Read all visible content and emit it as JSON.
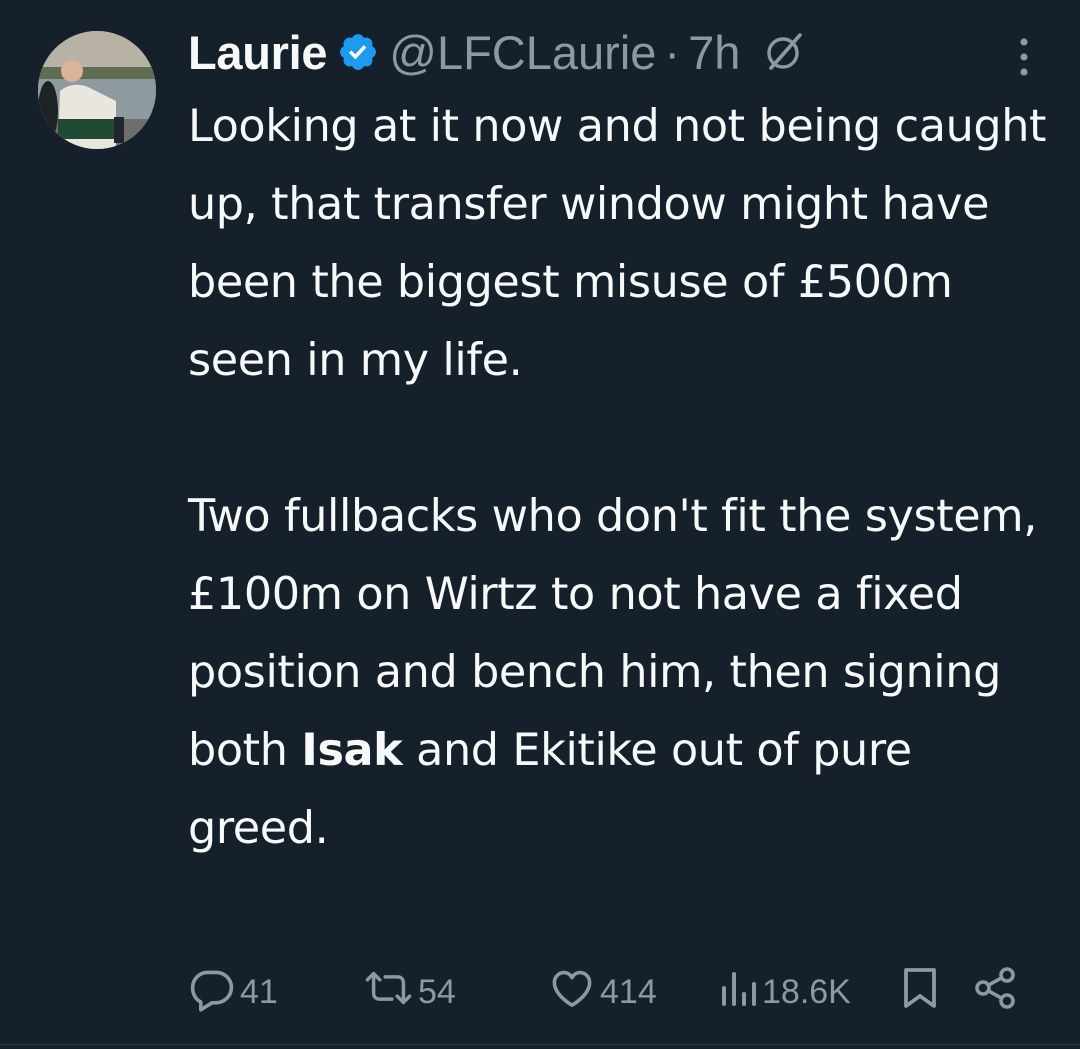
{
  "author": {
    "name": "Laurie",
    "handle": "@LFCLaurie",
    "separator": "·",
    "time": "7h",
    "verified": true,
    "accent_color": "#1d9bf0"
  },
  "tweet": {
    "paragraph1": "Looking at it now and not being caught up, that transfer window might have been the biggest misuse of £500m seen in my life.",
    "paragraph2_before_bold": "Two fullbacks who don't fit the system, £100m on Wirtz to not have a fixed position and bench him, then signing both ",
    "paragraph2_bold": "Isak",
    "paragraph2_after_bold": " and Ekitike out of pure greed."
  },
  "actions": {
    "replies": "41",
    "reposts": "54",
    "likes": "414",
    "views": "18.6K"
  },
  "icons": {
    "avatar": "profile-photo",
    "verified": "verified-badge-icon",
    "grok": "grok-icon",
    "more": "more-vertical-icon",
    "reply": "reply-icon",
    "repost": "repost-icon",
    "like": "heart-icon",
    "views": "views-icon",
    "bookmark": "bookmark-icon",
    "share": "share-icon"
  },
  "colors": {
    "background": "#15202b",
    "text": "#f7f9f9",
    "muted": "#8b98a5"
  }
}
